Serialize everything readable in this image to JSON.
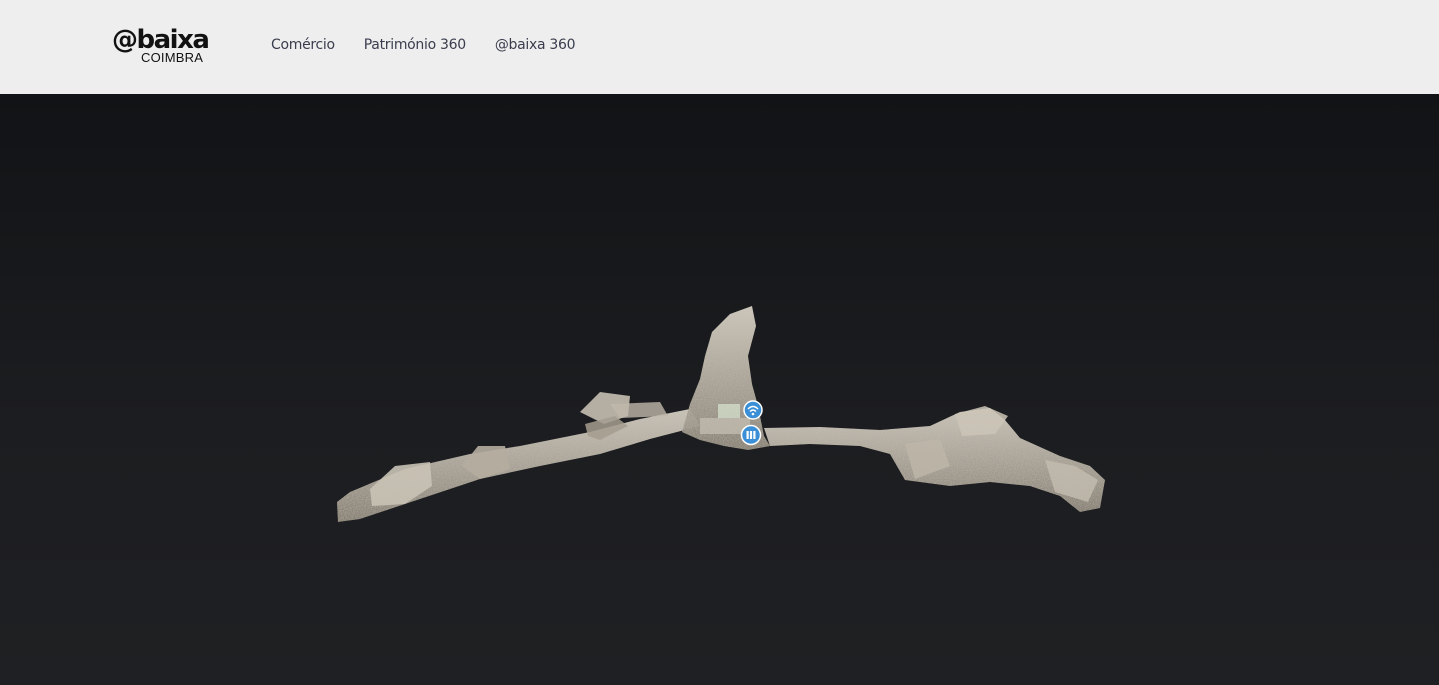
{
  "header": {
    "logo": {
      "main": "@baixa",
      "sub": "COIMBRA"
    },
    "nav": [
      {
        "label": "Comércio"
      },
      {
        "label": "Património 360"
      },
      {
        "label": "@baixa 360"
      }
    ]
  },
  "viewer": {
    "background_top": "#121316",
    "background_bottom": "#1f2023",
    "model_color": "#bdb6a8",
    "marker_color": "#3b8fd6",
    "markers": [
      {
        "icon": "wifi-icon"
      },
      {
        "icon": "info-icon"
      }
    ]
  },
  "colors": {
    "header_bg": "#eeeeee",
    "nav_text": "#3a3d4d",
    "logo_text": "#121212"
  }
}
